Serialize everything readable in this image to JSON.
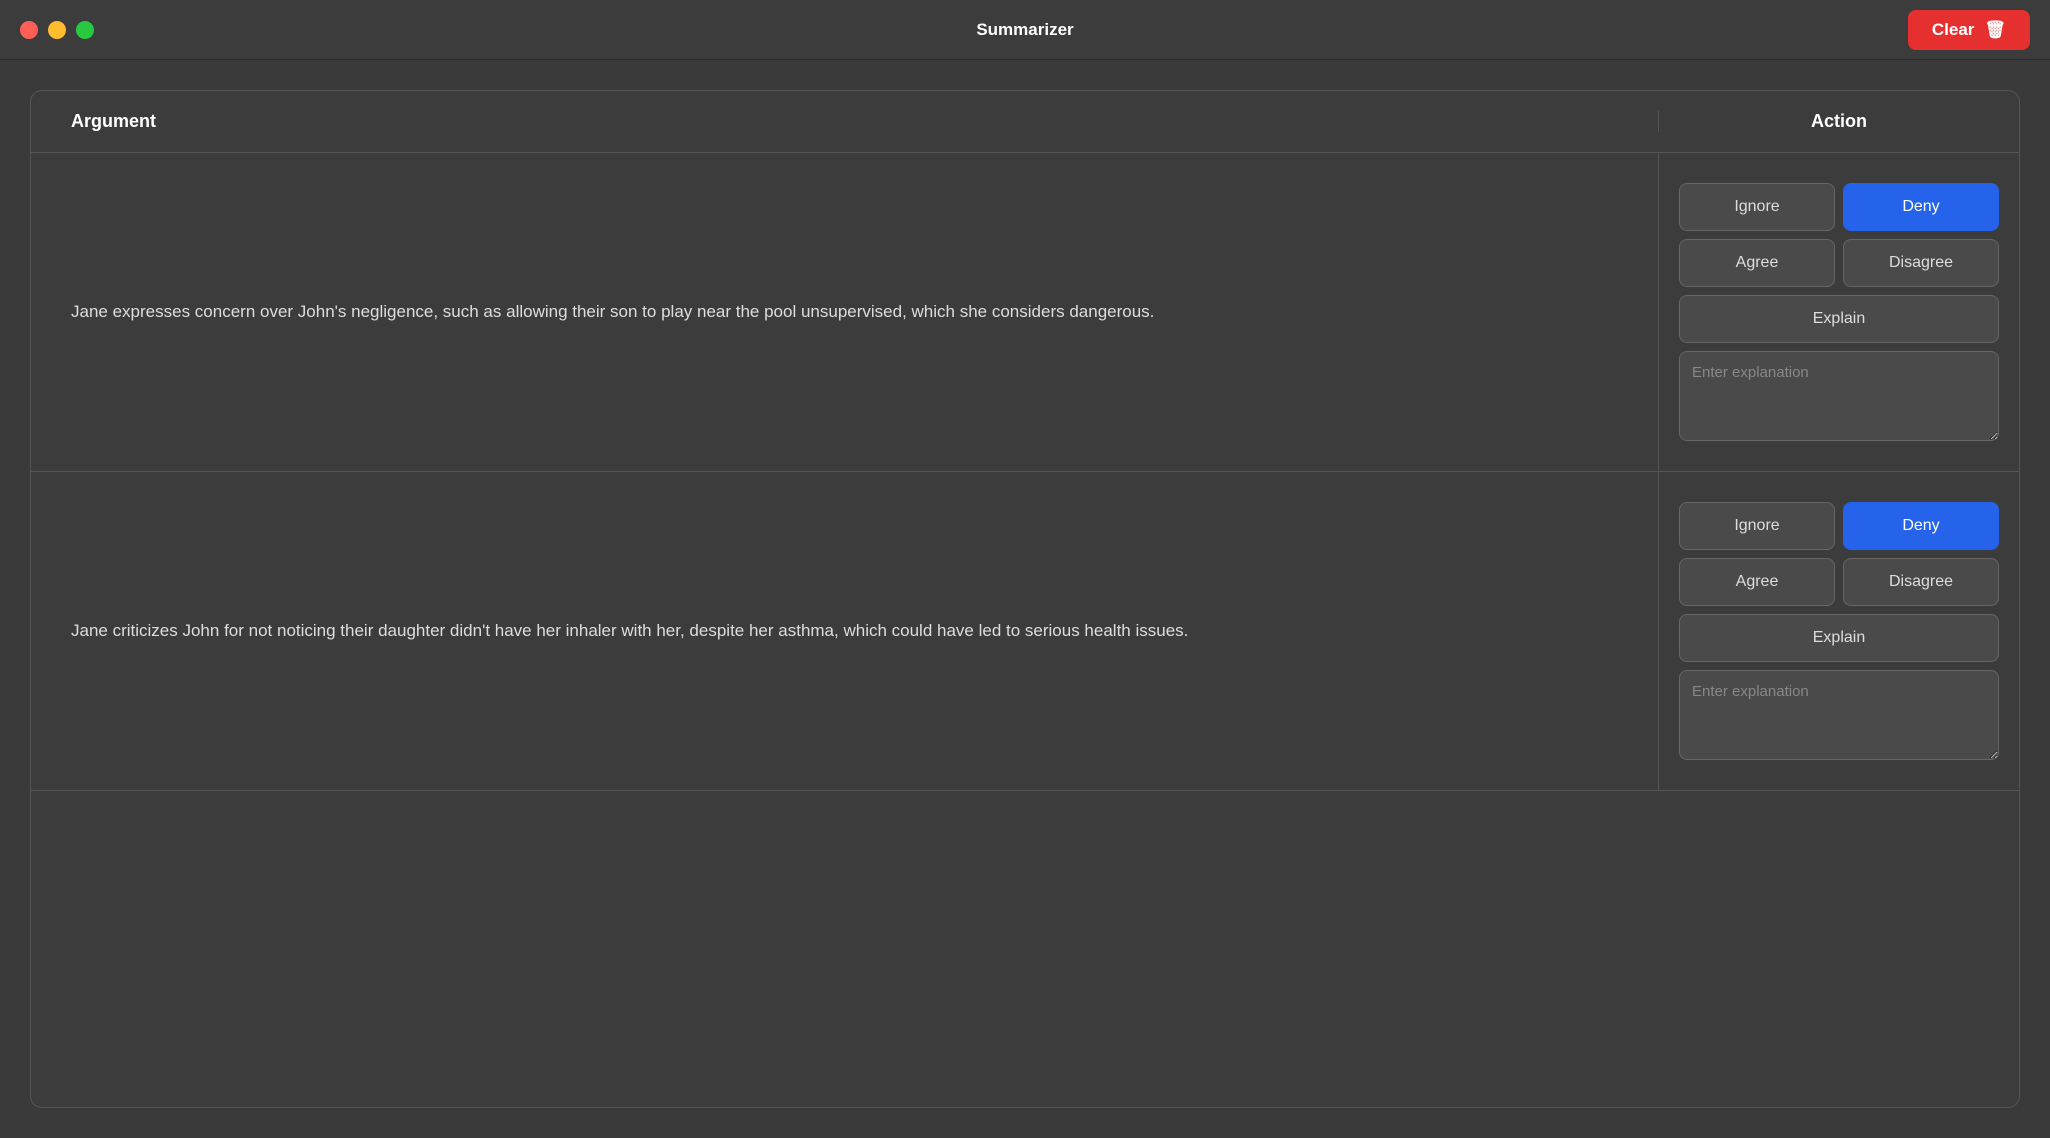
{
  "titlebar": {
    "title": "Summarizer",
    "clear_label": "Clear",
    "traffic_lights": {
      "close": "close",
      "minimize": "minimize",
      "maximize": "maximize"
    }
  },
  "table": {
    "headers": {
      "argument": "Argument",
      "action": "Action"
    },
    "rows": [
      {
        "id": "row-1",
        "argument": "Jane expresses concern over John's negligence, such as allowing their son to play near the pool unsupervised, which she considers dangerous.",
        "actions": {
          "ignore_label": "Ignore",
          "deny_label": "Deny",
          "agree_label": "Agree",
          "disagree_label": "Disagree",
          "explain_label": "Explain",
          "explanation_placeholder": "Enter explanation",
          "selected": "deny"
        }
      },
      {
        "id": "row-2",
        "argument": "Jane criticizes John for not noticing their daughter didn't have her inhaler with her, despite her asthma, which could have led to serious health issues.",
        "actions": {
          "ignore_label": "Ignore",
          "deny_label": "Deny",
          "agree_label": "Agree",
          "disagree_label": "Disagree",
          "explain_label": "Explain",
          "explanation_placeholder": "Enter explanation",
          "selected": "deny"
        }
      }
    ]
  }
}
